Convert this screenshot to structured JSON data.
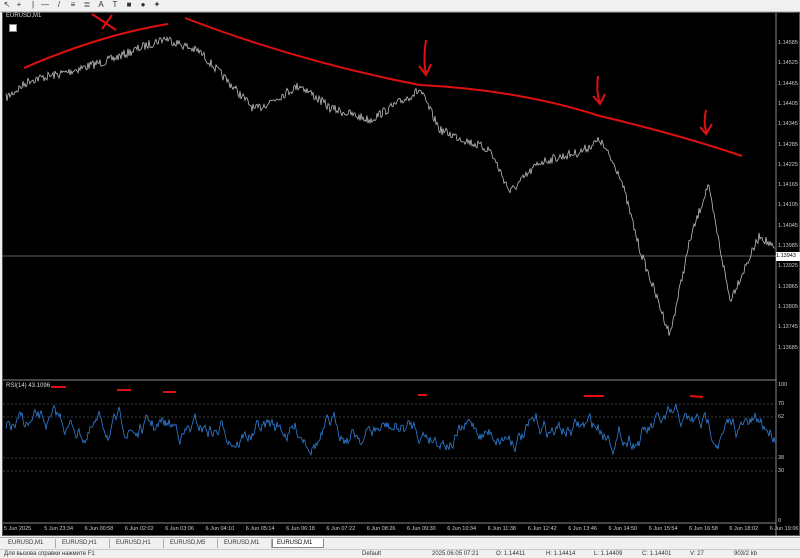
{
  "toolbar": {
    "icons": [
      "cursor-icon",
      "crosshair-icon",
      "vertical-line-icon",
      "horizontal-line-icon",
      "trendline-icon",
      "channel-icon",
      "fibonacci-icon",
      "text-icon",
      "label-icon",
      "rectangle-icon",
      "ellipse-icon",
      "shapes-icon"
    ]
  },
  "chart": {
    "title": "EURUSD,M1",
    "rsi_label": "RSI(14) 43.1096",
    "current_price": "1.13943",
    "price_ticks": [
      "1.14585",
      "1.14525",
      "1.14465",
      "1.14405",
      "1.14345",
      "1.14285",
      "1.14225",
      "1.14165",
      "1.14105",
      "1.14045",
      "1.13985",
      "1.13925",
      "1.13865",
      "1.13805",
      "1.13745",
      "1.13685"
    ],
    "rsi_ticks": [
      "100",
      "70",
      "62",
      "38",
      "30",
      "0"
    ],
    "time_ticks": [
      "5 Jun 2025",
      "5 Jun 23:34",
      "6 Jun 00:58",
      "6 Jun 02:02",
      "6 Jun 03:06",
      "6 Jun 04:10",
      "6 Jun 05:14",
      "6 Jun 06:18",
      "6 Jun 07:22",
      "6 Jun 08:26",
      "6 Jun 09:30",
      "6 Jun 10:34",
      "6 Jun 11:38",
      "6 Jun 12:42",
      "6 Jun 13:46",
      "6 Jun 14:50",
      "6 Jun 15:54",
      "6 Jun 16:58",
      "6 Jun 18:02",
      "6 Jun 19:06"
    ],
    "colors": {
      "price": "#bdbdbd",
      "rsi": "#2f7fd8",
      "annotation": "#e01010",
      "background": "#000000"
    }
  },
  "tabs": [
    "EURUSD,M1",
    "EURUSD,H1",
    "EURUSD,H1",
    "EURUSD,M5",
    "EURUSD,M1",
    "EURUSD,M1"
  ],
  "active_tab": "EURUSD,M1",
  "status": {
    "hint": "Для вызова справки нажмите F1",
    "profile": "Default",
    "datetime": "2025.06.05 07:21",
    "open": "O: 1.14411",
    "high": "H: 1.14414",
    "low": "L: 1.14409",
    "close": "C: 1.14401",
    "volume": "V: 27",
    "traffic": "903/2 kb"
  }
}
